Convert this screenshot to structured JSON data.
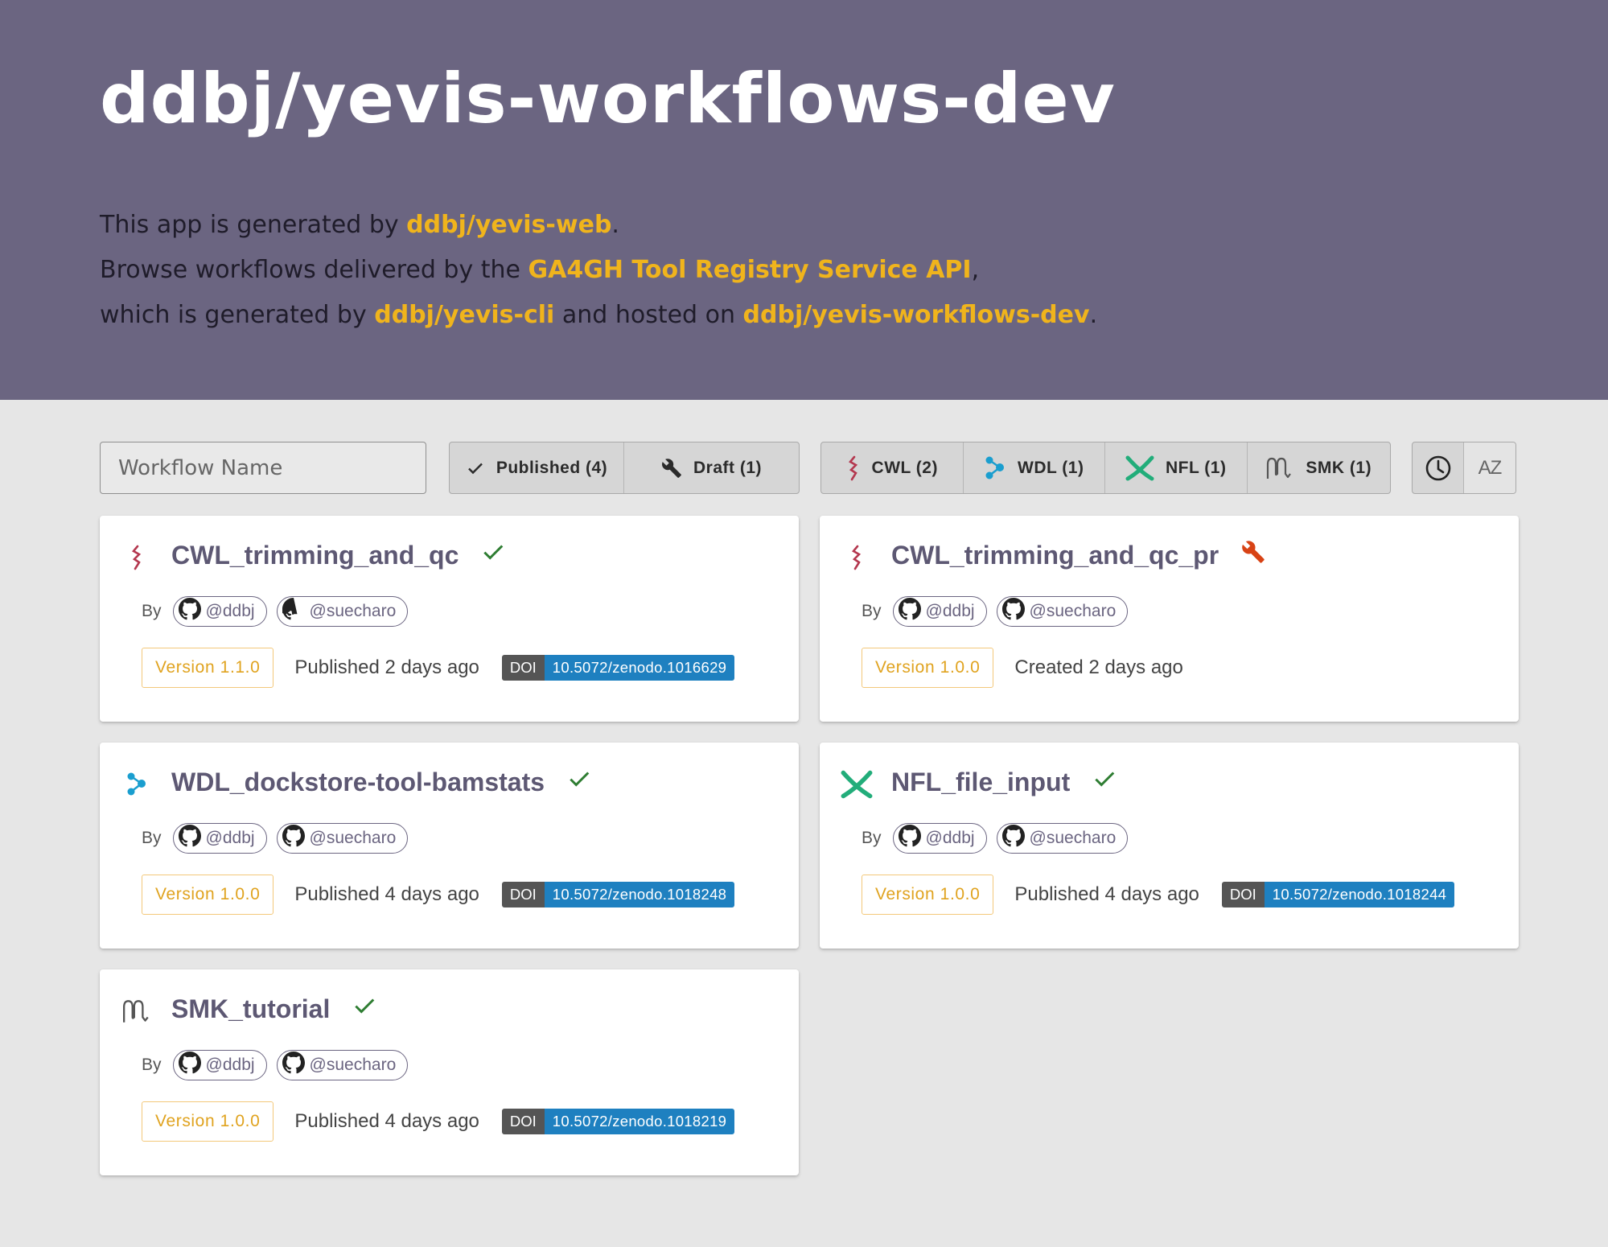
{
  "header": {
    "title": "ddbj/yevis-workflows-dev",
    "intro": {
      "line1_prefix": "This app is generated by ",
      "line1_link": "ddbj/yevis-web",
      "line1_suffix": ".",
      "line2_prefix": "Browse workflows delivered by the ",
      "line2_link": "GA4GH Tool Registry Service API",
      "line2_suffix": ",",
      "line3_prefix": "which is generated by ",
      "line3_link1": "ddbj/yevis-cli",
      "line3_mid": " and hosted on ",
      "line3_link2": "ddbj/yevis-workflows-dev",
      "line3_suffix": "."
    }
  },
  "toolbar": {
    "search_placeholder": "Workflow Name",
    "status_filters": [
      {
        "label": "Published (4)",
        "icon": "check-icon"
      },
      {
        "label": "Draft (1)",
        "icon": "wrench-icon"
      }
    ],
    "language_filters": [
      {
        "label": "CWL (2)",
        "icon": "cwl-icon"
      },
      {
        "label": "WDL (1)",
        "icon": "wdl-icon"
      },
      {
        "label": "NFL (1)",
        "icon": "nfl-icon"
      },
      {
        "label": "SMK (1)",
        "icon": "smk-icon"
      }
    ],
    "sort_buttons": [
      {
        "icon": "clock-icon"
      },
      {
        "icon": "sort-az-icon",
        "label": "AZ"
      }
    ]
  },
  "colors": {
    "header_bg": "#6b6581",
    "link": "#f0b41c",
    "published_check": "#2e7d32",
    "draft_wrench": "#d84315",
    "doi_blue": "#1e80c0"
  },
  "workflows": [
    {
      "name": "CWL_trimming_and_qc",
      "language": "CWL",
      "status": "published",
      "by_label": "By",
      "authors": [
        "@ddbj",
        "@suecharo"
      ],
      "version": "Version 1.1.0",
      "status_text": "Published 2 days ago",
      "doi_label": "DOI",
      "doi": "10.5072/zenodo.1016629"
    },
    {
      "name": "CWL_trimming_and_qc_pr",
      "language": "CWL",
      "status": "draft",
      "by_label": "By",
      "authors": [
        "@ddbj",
        "@suecharo"
      ],
      "version": "Version 1.0.0",
      "status_text": "Created 2 days ago"
    },
    {
      "name": "WDL_dockstore-tool-bamstats",
      "language": "WDL",
      "status": "published",
      "by_label": "By",
      "authors": [
        "@ddbj",
        "@suecharo"
      ],
      "version": "Version 1.0.0",
      "status_text": "Published 4 days ago",
      "doi_label": "DOI",
      "doi": "10.5072/zenodo.1018248"
    },
    {
      "name": "NFL_file_input",
      "language": "NFL",
      "status": "published",
      "by_label": "By",
      "authors": [
        "@ddbj",
        "@suecharo"
      ],
      "version": "Version 1.0.0",
      "status_text": "Published 4 days ago",
      "doi_label": "DOI",
      "doi": "10.5072/zenodo.1018244"
    },
    {
      "name": "SMK_tutorial",
      "language": "SMK",
      "status": "published",
      "by_label": "By",
      "authors": [
        "@ddbj",
        "@suecharo"
      ],
      "version": "Version 1.0.0",
      "status_text": "Published 4 days ago",
      "doi_label": "DOI",
      "doi": "10.5072/zenodo.1018219"
    }
  ]
}
